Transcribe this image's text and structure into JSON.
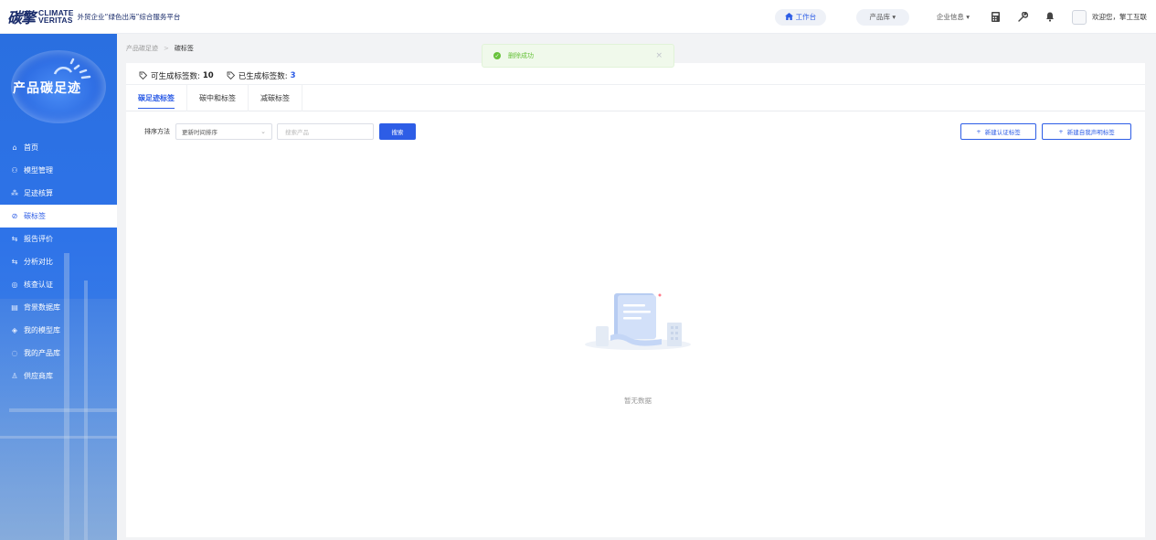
{
  "header": {
    "logo_cn": "碳擎",
    "logo_en_line1": "CLIMATE",
    "logo_en_line2": "VERITAS",
    "tagline": "外贸企业“绿色出海”综合服务平台",
    "workbench": "工作台",
    "product_lib": "产品库 ▾",
    "company_info": "企业信息 ▾",
    "welcome": "欢迎您，擎工互联"
  },
  "sidebar": {
    "title": "产品碳足迹",
    "items": [
      {
        "label": "首页",
        "icon": "home-icon",
        "glyph": "⌂"
      },
      {
        "label": "模型管理",
        "icon": "model-icon",
        "glyph": "⚇"
      },
      {
        "label": "足迹核算",
        "icon": "footprint-icon",
        "glyph": "⁂"
      },
      {
        "label": "碳标签",
        "icon": "tag-icon",
        "glyph": "⊘"
      },
      {
        "label": "报告评价",
        "icon": "report-icon",
        "glyph": "⇆"
      },
      {
        "label": "分析对比",
        "icon": "compare-icon",
        "glyph": "⇆"
      },
      {
        "label": "核查认证",
        "icon": "shield-icon",
        "glyph": "◎"
      },
      {
        "label": "背景数据库",
        "icon": "database-icon",
        "glyph": "▤"
      },
      {
        "label": "我的模型库",
        "icon": "cube-icon",
        "glyph": "◈"
      },
      {
        "label": "我的产品库",
        "icon": "product-icon",
        "glyph": "◌"
      },
      {
        "label": "供应商库",
        "icon": "supplier-icon",
        "glyph": "♙"
      }
    ],
    "active_index": 3
  },
  "breadcrumb": {
    "parent": "产品碳足迹",
    "sep": ">",
    "current": "碳标签"
  },
  "toast": {
    "message": "删除成功",
    "close": "×"
  },
  "stats": {
    "available_label": "可生成标签数:",
    "available_value": "10",
    "generated_label": "已生成标签数:",
    "generated_value": "3"
  },
  "tabs": [
    {
      "label": "碳足迹标签"
    },
    {
      "label": "碳中和标签"
    },
    {
      "label": "减碳标签"
    }
  ],
  "filter": {
    "sort_label": "排序方法",
    "sort_value": "更新时间排序",
    "search_placeholder": "搜索产品",
    "search_button": "搜索",
    "new_cert_label": "新建认证标签",
    "new_self_label": "新建自我声明标签"
  },
  "empty": {
    "text": "暂无数据"
  },
  "colors": {
    "primary": "#2d5de6",
    "success": "#67c23a",
    "sidebar": "#2e73e8"
  }
}
